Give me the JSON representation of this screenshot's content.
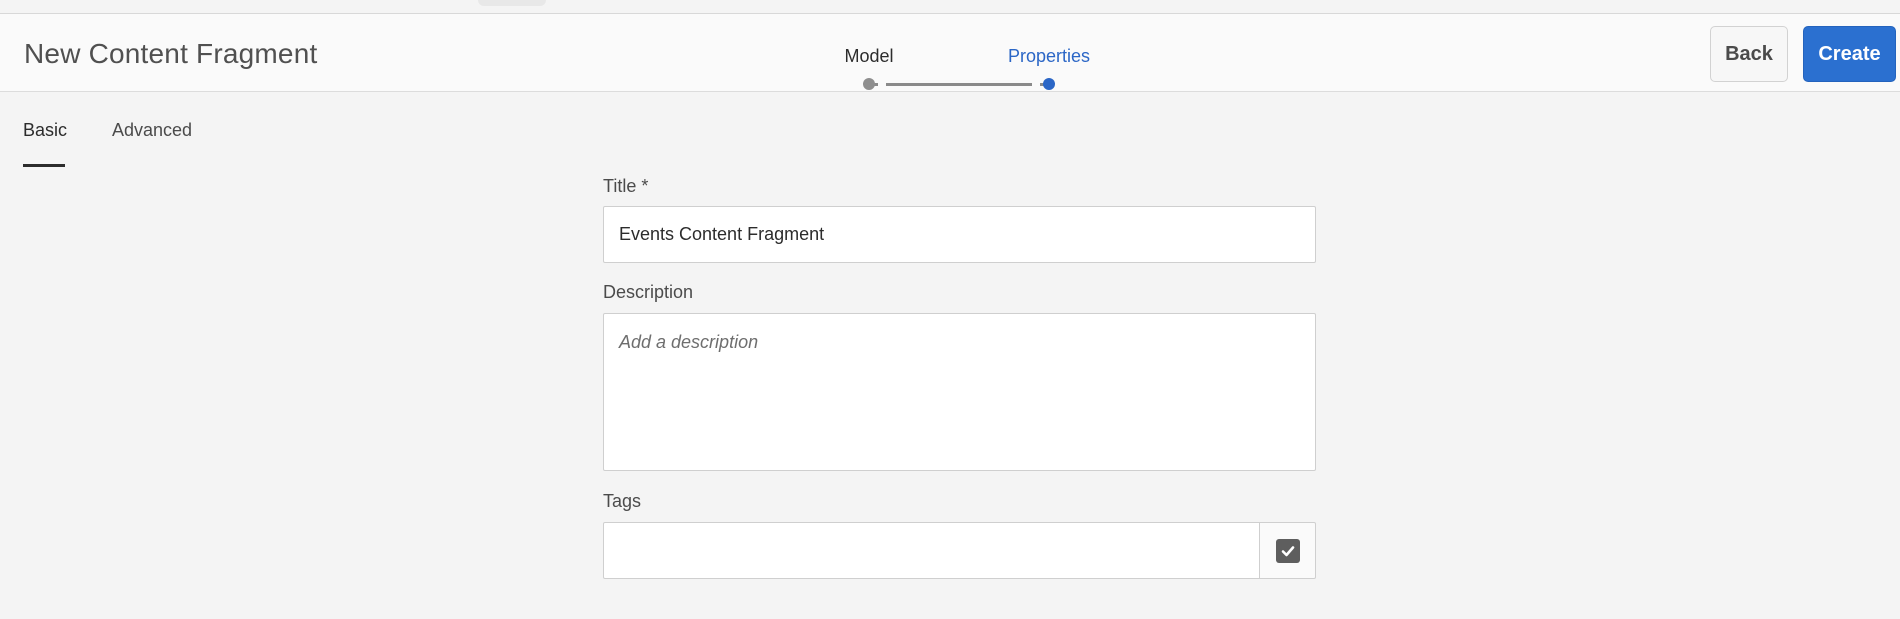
{
  "header": {
    "title": "New Content Fragment",
    "back_label": "Back",
    "create_label": "Create"
  },
  "stepper": {
    "steps": [
      {
        "label": "Model",
        "state": "completed"
      },
      {
        "label": "Properties",
        "state": "current"
      }
    ]
  },
  "tabs": [
    {
      "label": "Basic",
      "selected": true
    },
    {
      "label": "Advanced",
      "selected": false
    }
  ],
  "form": {
    "title": {
      "label": "Title *",
      "value": "Events Content Fragment"
    },
    "description": {
      "label": "Description",
      "placeholder": "Add a description",
      "value": ""
    },
    "tags": {
      "label": "Tags",
      "value": "",
      "picker_icon": "checkbox-checked-icon"
    }
  },
  "colors": {
    "accent": "#2b70d0",
    "step_active": "#2b66c6",
    "step_inactive": "#8e8e8e",
    "background": "#f4f4f4"
  }
}
